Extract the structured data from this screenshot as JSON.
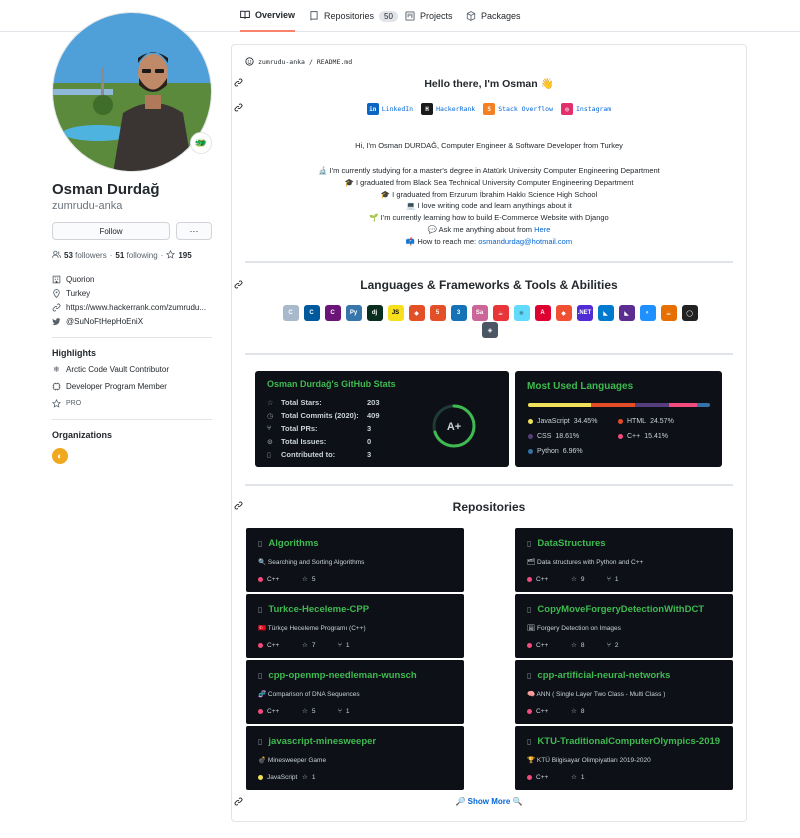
{
  "tabs": [
    {
      "label": "Overview",
      "icon": "book-icon",
      "active": true
    },
    {
      "label": "Repositories",
      "icon": "repo-icon",
      "count": "50"
    },
    {
      "label": "Projects",
      "icon": "project-icon"
    },
    {
      "label": "Packages",
      "icon": "package-icon"
    }
  ],
  "profile": {
    "fullname": "Osman Durdağ",
    "username": "zumrudu-anka",
    "follow_label": "Follow",
    "more_label": "···",
    "followers_count": "53",
    "followers_label": "followers",
    "following_count": "51",
    "following_label": "following",
    "stars_count": "195",
    "company": "Quorion",
    "location": "Turkey",
    "website": "https://www.hackerrank.com/zumrudu...",
    "twitter": "@SuNoFtHepHoEniX",
    "status_emoji": "🐲"
  },
  "highlights": {
    "title": "Highlights",
    "items": [
      "Arctic Code Vault Contributor",
      "Developer Program Member"
    ],
    "pro_label": "PRO"
  },
  "organizations": {
    "title": "Organizations"
  },
  "readme": {
    "path_user": "zumrudu-anka",
    "path_sep": "/",
    "path_file": "README.md",
    "hello": "Hello there, I'm Osman 👋",
    "social": [
      "LinkedIn",
      "HackerRank",
      "Stack Overflow",
      "Instagram"
    ],
    "intro": "Hi, I'm Osman DURDAĞ, Computer Engineer & Software Developer from Turkey",
    "bullets": [
      "🔬 I'm currently studying for a master's degree in Atatürk University Computer Engineering Department",
      "🎓 I graduated from Black Sea Technical University Computer Engineering Department",
      "🎓 I graduated from Erzurum İbrahim Hakkı Science High School",
      "💻 I love writing code and learn anythings about it",
      "🌱 I'm currently learning how to build E-Commerce Website with Django"
    ],
    "ask_prefix": "💬 Ask me anything about from",
    "ask_link": "Here",
    "reach_prefix": "📫 How to reach me:",
    "reach_email": "osmandurdag@hotmail.com",
    "tools_title": "Languages & Frameworks & Tools & Abilities",
    "repos_title": "Repositories",
    "show_more": "🔎 Show More 🔍"
  },
  "tools": [
    {
      "name": "c-icon",
      "label": "C",
      "color": "#a8b9cc"
    },
    {
      "name": "cpp-icon",
      "label": "C",
      "color": "#00599c"
    },
    {
      "name": "csharp-icon",
      "label": "C",
      "color": "#6a1577"
    },
    {
      "name": "python-icon",
      "label": "Py",
      "color": "#3776ab"
    },
    {
      "name": "django-icon",
      "label": "dj",
      "color": "#092e20"
    },
    {
      "name": "javascript-icon",
      "label": "JS",
      "color": "#f7df1e"
    },
    {
      "name": "tools-icon",
      "label": "◆",
      "color": "#e34f26"
    },
    {
      "name": "html5-icon",
      "label": "5",
      "color": "#e34f26"
    },
    {
      "name": "css3-icon",
      "label": "3",
      "color": "#1572b6"
    },
    {
      "name": "sass-icon",
      "label": "Sa",
      "color": "#cc6699"
    },
    {
      "name": "java-cup-icon",
      "label": "☕",
      "color": "#e8353a"
    },
    {
      "name": "react-icon",
      "label": "⚛",
      "color": "#61dafb"
    },
    {
      "name": "angular-icon",
      "label": "A",
      "color": "#dd0031"
    },
    {
      "name": "git-icon",
      "label": "◆",
      "color": "#f05032"
    },
    {
      "name": "dotnet-icon",
      "label": ".NET",
      "color": "#512bd4"
    },
    {
      "name": "visual-studio-code-icon",
      "label": "◣",
      "color": "#007acc"
    },
    {
      "name": "visual-studio-icon",
      "label": "◣",
      "color": "#5c2d91"
    },
    {
      "name": "jetbrains-icon",
      "label": "◐",
      "color": "#1e90ff"
    },
    {
      "name": "java-icon",
      "label": "☕",
      "color": "#e76f00"
    },
    {
      "name": "unity-icon",
      "label": "◯",
      "color": "#222222"
    },
    {
      "name": "unity-cube-icon",
      "label": "◈",
      "color": "#4b5563"
    }
  ],
  "stats": {
    "title": "Osman Durdağ's GitHub Stats",
    "rows": [
      {
        "label": "Total Stars:",
        "value": "203",
        "icon": "star-icon"
      },
      {
        "label": "Total Commits (2020):",
        "value": "409",
        "icon": "history-icon"
      },
      {
        "label": "Total PRs:",
        "value": "3",
        "icon": "pr-icon"
      },
      {
        "label": "Total Issues:",
        "value": "0",
        "icon": "issue-icon"
      },
      {
        "label": "Contributed to:",
        "value": "3",
        "icon": "repo-icon"
      }
    ],
    "grade": "A+",
    "grade_fraction": 0.7
  },
  "languages": {
    "title": "Most Used Languages",
    "items": [
      {
        "name": "JavaScript",
        "percent": "34.45%",
        "value": 34.45,
        "color": "#f1e05a"
      },
      {
        "name": "HTML",
        "percent": "24.57%",
        "value": 24.57,
        "color": "#e34c26"
      },
      {
        "name": "CSS",
        "percent": "18.61%",
        "value": 18.61,
        "color": "#563d7c"
      },
      {
        "name": "C++",
        "percent": "15.41%",
        "value": 15.41,
        "color": "#f34b7d"
      },
      {
        "name": "Python",
        "percent": "6.96%",
        "value": 6.96,
        "color": "#3572a5"
      }
    ]
  },
  "repos": [
    {
      "name": "Algorithms",
      "desc": "🔍 Searching and Sorting Algorithms",
      "lang": "C++",
      "lang_color": "#f34b7d",
      "stars": "5",
      "forks": ""
    },
    {
      "name": "DataStructures",
      "desc": "🗂 Data structures with Python and C++",
      "lang": "C++",
      "lang_color": "#f34b7d",
      "stars": "9",
      "forks": "1"
    },
    {
      "name": "Turkce-Heceleme-CPP",
      "desc": "🇹🇷 Türkçe Heceleme Programı (C++)",
      "lang": "C++",
      "lang_color": "#f34b7d",
      "stars": "7",
      "forks": "1"
    },
    {
      "name": "CopyMoveForgeryDetectionWithDCT",
      "desc": "🖼 Forgery Detection on Images",
      "lang": "C++",
      "lang_color": "#f34b7d",
      "stars": "8",
      "forks": "2"
    },
    {
      "name": "cpp-openmp-needleman-wunsch",
      "desc": "🧬 Comparison of DNA Sequences",
      "lang": "C++",
      "lang_color": "#f34b7d",
      "stars": "5",
      "forks": "1"
    },
    {
      "name": "cpp-artificial-neural-networks",
      "desc": "🧠 ANN ( Single Layer Two Class - Multi Class )",
      "lang": "C++",
      "lang_color": "#f34b7d",
      "stars": "8",
      "forks": ""
    },
    {
      "name": "javascript-minesweeper",
      "desc": "💣 Minesweeper Game",
      "lang": "JavaScript",
      "lang_color": "#f1e05a",
      "stars": "1",
      "forks": ""
    },
    {
      "name": "KTU-TraditionalComputerOlympics-2019",
      "desc": "🏆 KTÜ Bilgisayar Olimpiyatları 2019-2020",
      "lang": "C++",
      "lang_color": "#f34b7d",
      "stars": "1",
      "forks": ""
    }
  ]
}
